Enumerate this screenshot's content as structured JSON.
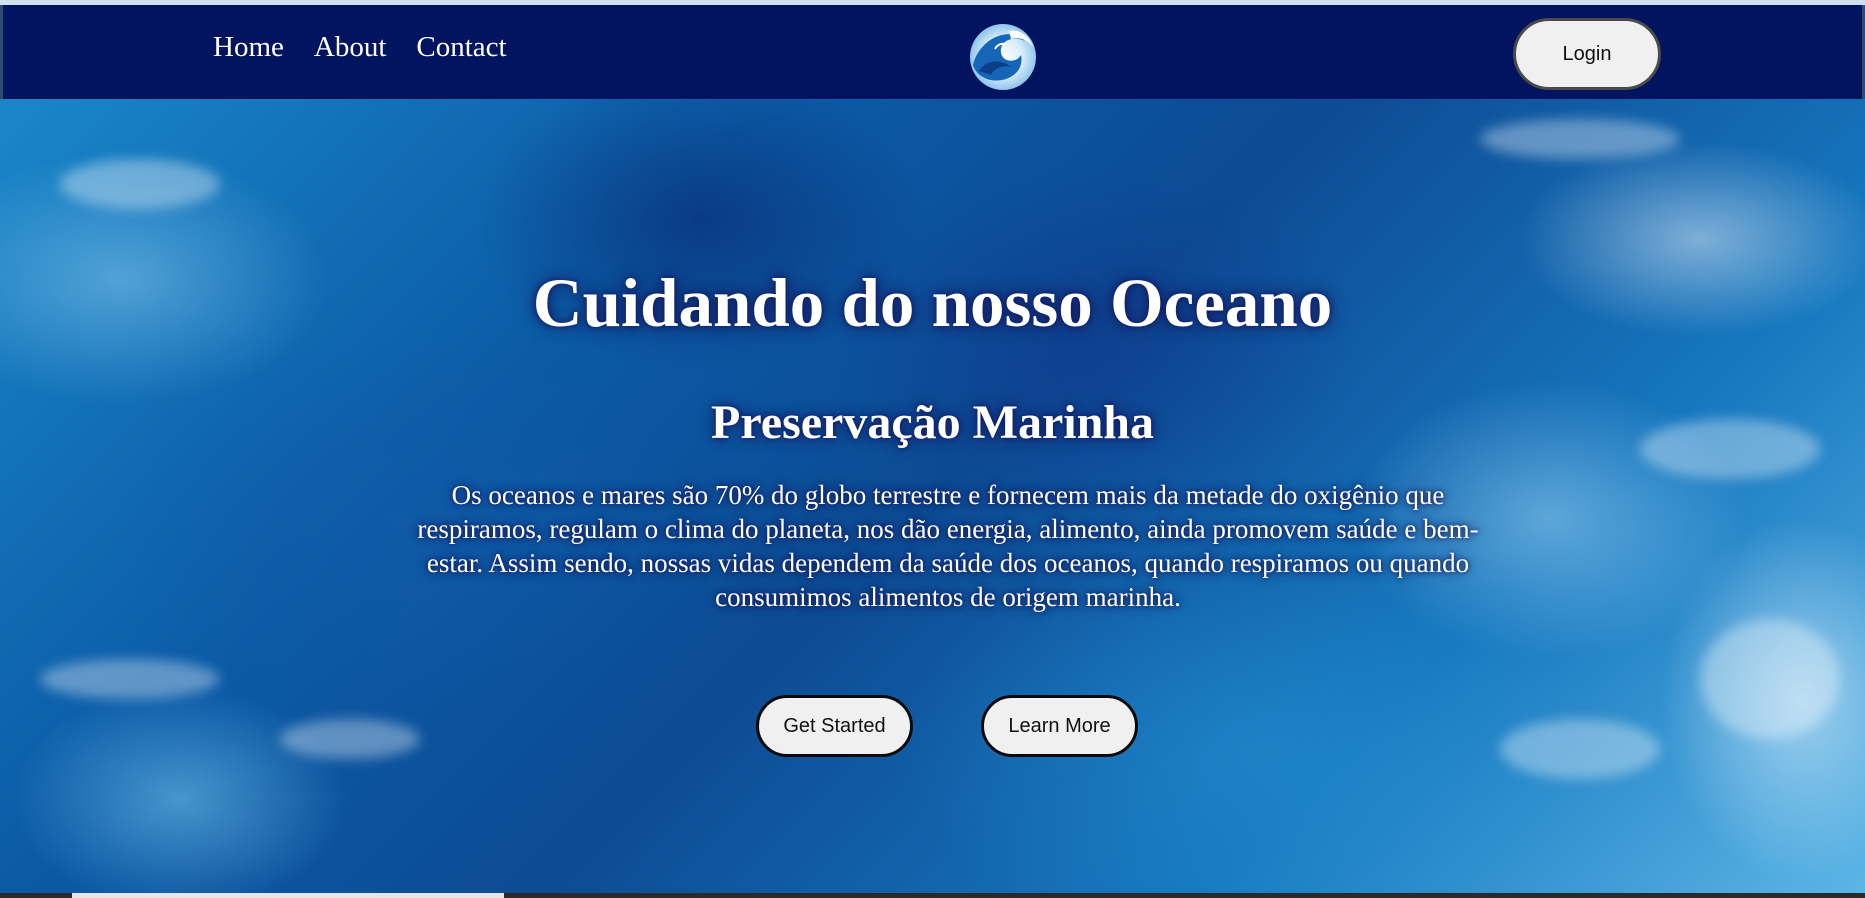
{
  "nav": {
    "links": [
      {
        "label": "Home"
      },
      {
        "label": "About"
      },
      {
        "label": "Contact"
      }
    ],
    "logo_icon": "wave-logo-icon",
    "login_label": "Login"
  },
  "hero": {
    "title": "Cuidando do nosso Oceano",
    "subtitle": "Preservação Marinha",
    "text": "Os oceanos e mares são 70% do globo terrestre e fornecem mais da metade do oxigênio que respiramos, regulam o clima do planeta, nos dão energia, alimento, ainda promovem saúde e bem-estar. Assim sendo, nossas vidas dependem da saúde dos oceanos, quando respiramos ou quando consumimos alimentos de origem marinha.",
    "buttons": {
      "get_started": "Get Started",
      "learn_more": "Learn More"
    }
  },
  "colors": {
    "navbar_bg": "#02135f",
    "button_bg": "#f0f0f0",
    "text": "#ffffff"
  }
}
